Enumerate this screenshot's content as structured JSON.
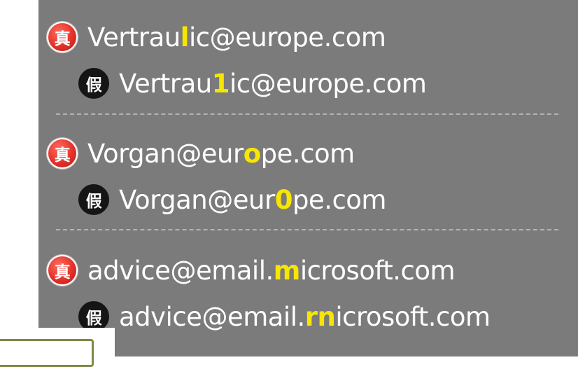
{
  "badges": {
    "real": "真",
    "fake": "假"
  },
  "groups": [
    {
      "real": {
        "before": "Vertrau",
        "highlight": "l",
        "after": "ic@europe.com"
      },
      "fake": {
        "before": "Vertrau",
        "highlight": "1",
        "after": "ic@europe.com"
      }
    },
    {
      "real": {
        "before": "Vorgan@eur",
        "highlight": "o",
        "after": "pe.com"
      },
      "fake": {
        "before": "Vorgan@eur",
        "highlight": "0",
        "after": "pe.com"
      }
    },
    {
      "real": {
        "before": "advice@email.",
        "highlight": "m",
        "after": "icrosoft.com"
      },
      "fake": {
        "before": "advice@email.",
        "highlight": "rn",
        "after": "icrosoft.com"
      }
    }
  ],
  "colors": {
    "panel_bg": "#7b7b7b",
    "text": "#ffffff",
    "highlight": "#f7e600",
    "real_badge": "#e3322a",
    "fake_badge": "#151515",
    "separator": "#b4b4b4",
    "frame": "#7d8a46"
  }
}
